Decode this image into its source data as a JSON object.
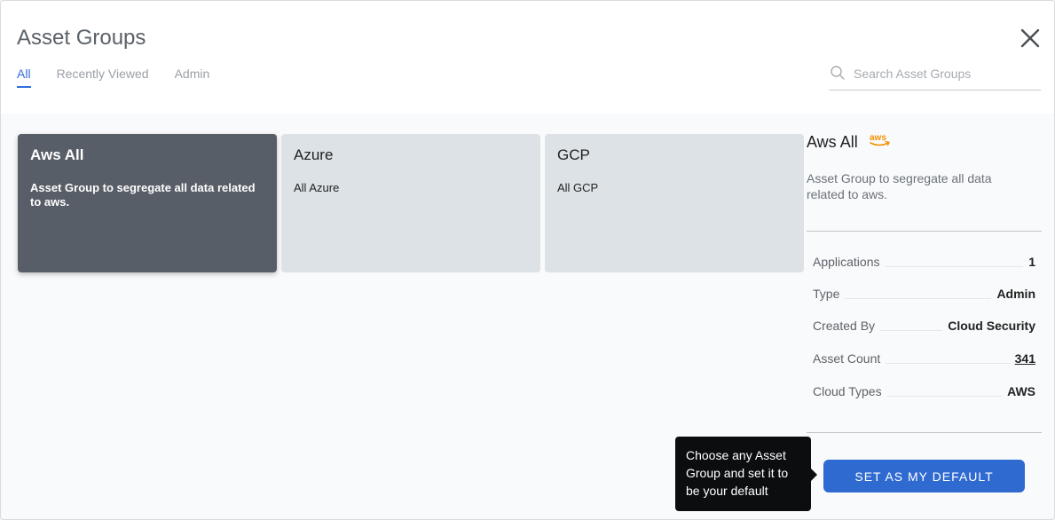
{
  "header": {
    "title": "Asset Groups",
    "tabs": [
      {
        "label": "All",
        "active": true
      },
      {
        "label": "Recently Viewed",
        "active": false
      },
      {
        "label": "Admin",
        "active": false
      }
    ],
    "search": {
      "placeholder": "Search Asset Groups",
      "value": "",
      "icon": "search-icon"
    },
    "close_icon": "close-icon"
  },
  "cards": [
    {
      "name": "Aws All",
      "description": "Asset Group to segregate all data related to aws.",
      "selected": true
    },
    {
      "name": "Azure",
      "description": "All Azure",
      "selected": false
    },
    {
      "name": "GCP",
      "description": "All GCP",
      "selected": false
    }
  ],
  "details": {
    "name": "Aws All",
    "logo": "aws",
    "description": "Asset Group to segregate all data related to aws.",
    "rows": [
      {
        "key": "Applications",
        "value": "1"
      },
      {
        "key": "Type",
        "value": "Admin"
      },
      {
        "key": "Created By",
        "value": "Cloud Security"
      },
      {
        "key": "Asset Count",
        "value": "341"
      },
      {
        "key": "Cloud Types",
        "value": "AWS"
      }
    ]
  },
  "tooltip": {
    "text": "Choose any Asset Group and set it to be your default"
  },
  "actions": {
    "set_default_label": "SET AS MY DEFAULT"
  },
  "colors": {
    "accent": "#2f6ad0",
    "selected_card": "#585e67",
    "card": "#dde2e7",
    "aws_orange": "#f29100"
  }
}
